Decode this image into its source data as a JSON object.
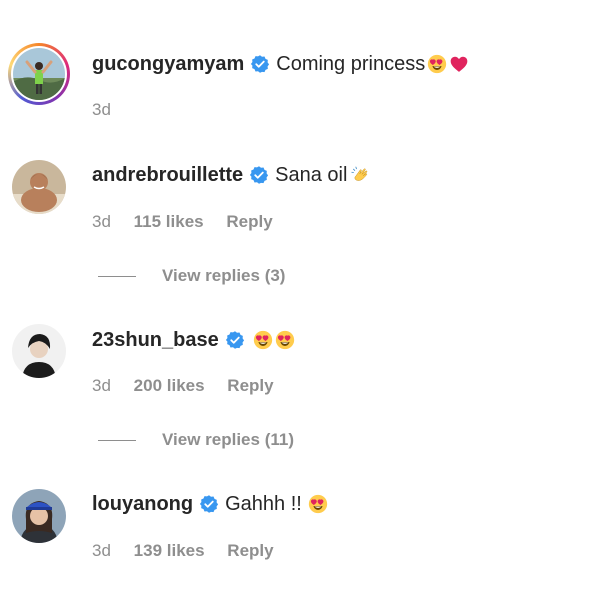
{
  "comments": [
    {
      "username": "gucongyamyam",
      "text": "Coming princess",
      "emojis": [
        "heart-eyes",
        "red-heart"
      ],
      "time": "3d",
      "likes": "",
      "reply": "",
      "has_story_ring": true
    },
    {
      "username": "andrebrouillette",
      "text": "Sana oil",
      "emojis": [
        "clapping-hands"
      ],
      "time": "3d",
      "likes": "115 likes",
      "reply": "Reply",
      "view_replies": "View replies (3)"
    },
    {
      "username": "23shun_base",
      "text": "",
      "emojis": [
        "heart-eyes",
        "heart-eyes"
      ],
      "time": "3d",
      "likes": "200 likes",
      "reply": "Reply",
      "view_replies": "View replies (11)"
    },
    {
      "username": "louyanong",
      "text": "Gahhh !!",
      "emojis": [
        "heart-eyes"
      ],
      "time": "3d",
      "likes": "139 likes",
      "reply": "Reply"
    }
  ],
  "colors": {
    "text": "#262626",
    "secondary": "#8e8e8e",
    "verified": "#3897f0"
  }
}
